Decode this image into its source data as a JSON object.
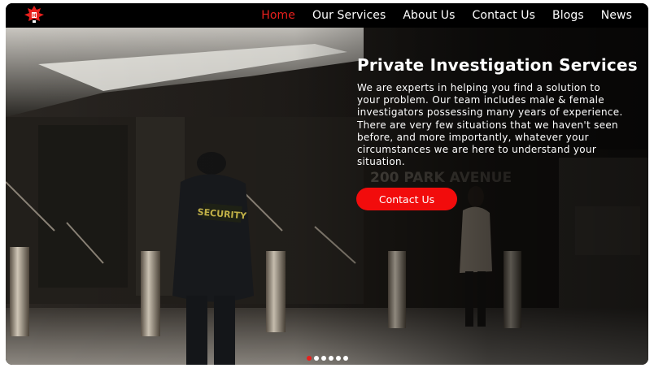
{
  "nav": {
    "logo_icon": "brand-logo-icon",
    "links": [
      {
        "label": "Home",
        "active": true
      },
      {
        "label": "Our Services",
        "active": false
      },
      {
        "label": "About Us",
        "active": false
      },
      {
        "label": "Contact Us",
        "active": false
      },
      {
        "label": "Blogs",
        "active": false
      },
      {
        "label": "News",
        "active": false
      }
    ]
  },
  "hero": {
    "title": "Private Investigation Services",
    "description": "We are experts in helping you find a solution to your problem. Our team includes male & female investigators possessing many years of experience. There are very few situations that we haven't seen before, and more importantly, whatever your circumstances we are here to understand your situation.",
    "cta_label": "Contact Us",
    "slides": {
      "count": 6,
      "active": 1
    }
  },
  "colors": {
    "accent": "#e8201d",
    "nav_bg": "#000000",
    "text": "#ffffff"
  }
}
